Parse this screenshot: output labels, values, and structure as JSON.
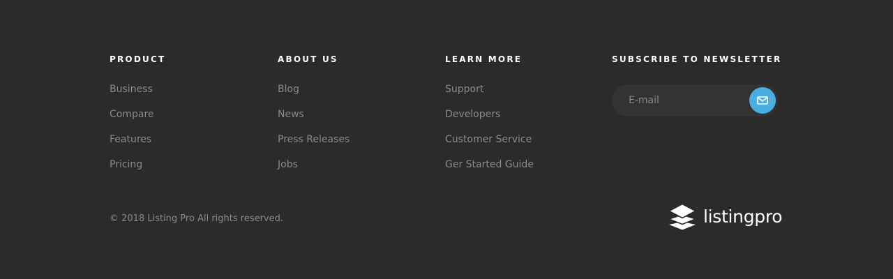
{
  "footer": {
    "columns": [
      {
        "heading": "PRODUCT",
        "links": [
          "Business",
          "Compare",
          "Features",
          "Pricing"
        ]
      },
      {
        "heading": "ABOUT US",
        "links": [
          "Blog",
          "News",
          "Press Releases",
          "Jobs"
        ]
      },
      {
        "heading": "LEARN MORE",
        "links": [
          "Support",
          "Developers",
          "Customer Service",
          "Ger Started Guide"
        ]
      }
    ],
    "newsletter": {
      "heading": "SUBSCRIBE TO NEWSLETTER",
      "placeholder": "E-mail",
      "button_icon": "envelope-icon"
    },
    "copyright": "© 2018 Listing Pro All rights reserved.",
    "brand": {
      "name": "listingpro",
      "icon": "stacked-layers-icon"
    }
  },
  "colors": {
    "background": "#2b2b2b",
    "heading": "#ffffff",
    "link": "#8a8a8a",
    "input_background": "#333333",
    "accent": "#4aaee0"
  }
}
